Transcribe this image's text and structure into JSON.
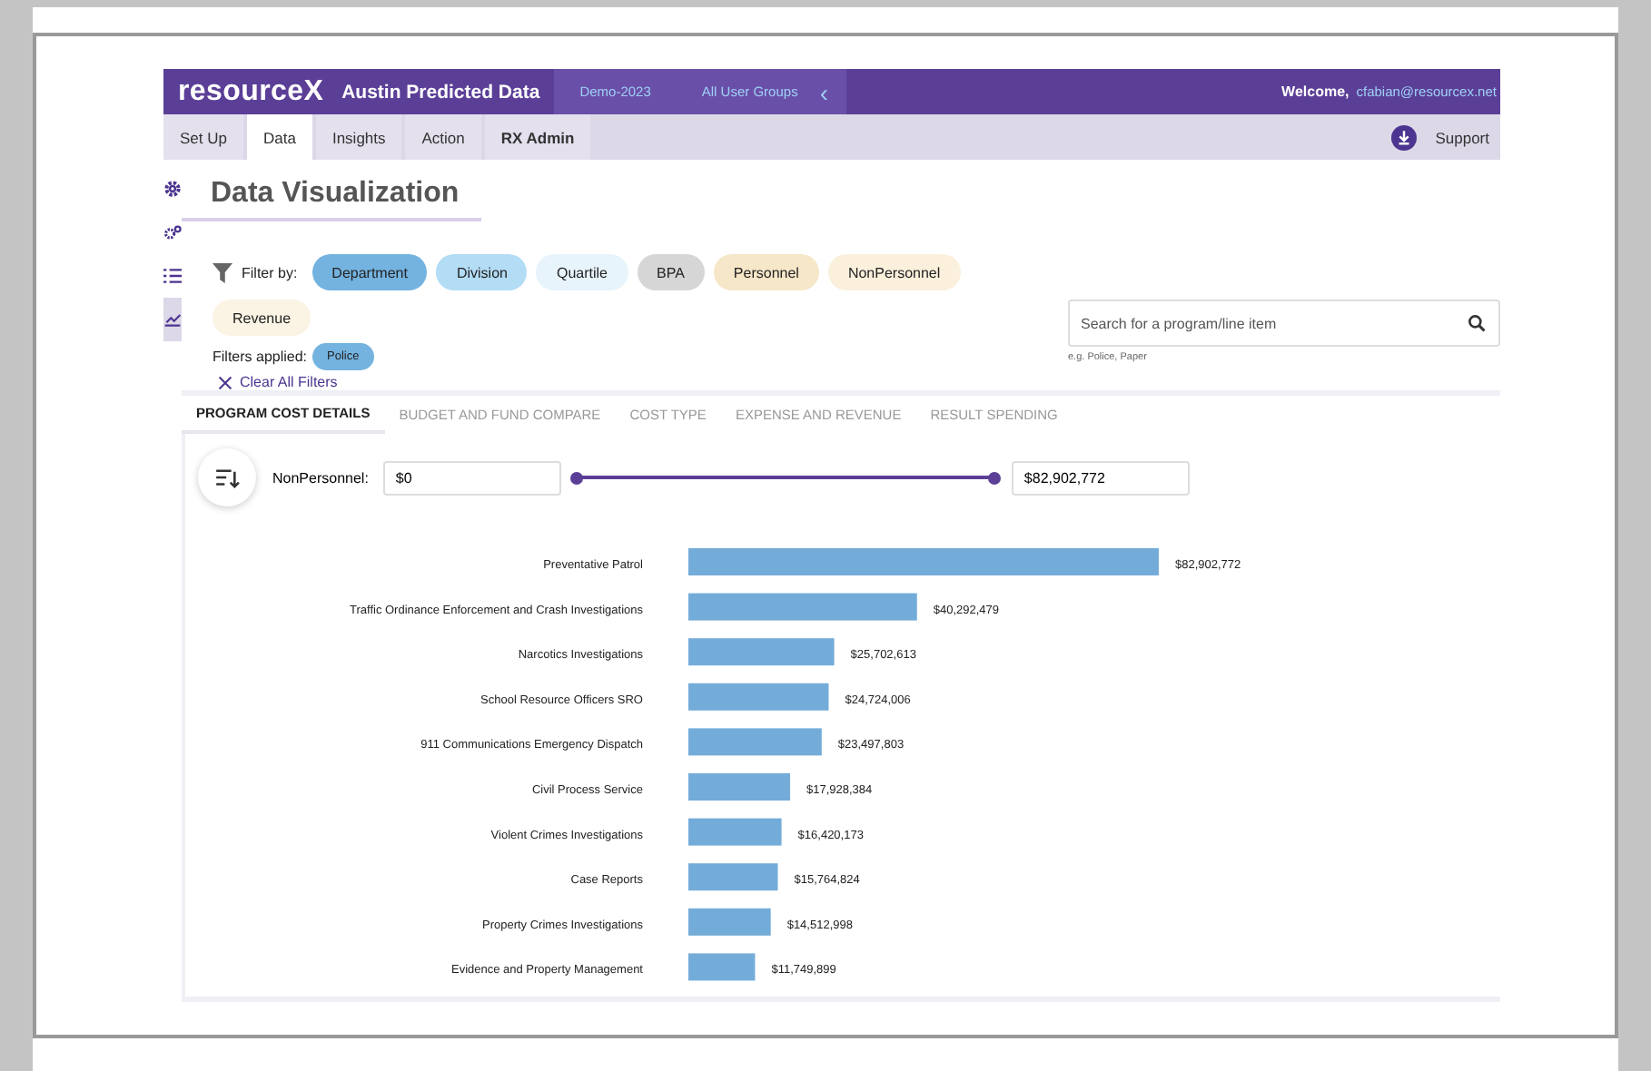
{
  "header": {
    "logo": "resourceX",
    "title": "Austin Predicted Data",
    "year": "Demo-2023",
    "group": "All User Groups",
    "collapse": "‹",
    "welcome": "Welcome,",
    "user": "cfabian@resourcex.net"
  },
  "nav": [
    {
      "label": "Set Up",
      "selected": false
    },
    {
      "label": "Data",
      "selected": true
    },
    {
      "label": "Insights",
      "selected": false
    },
    {
      "label": "Action",
      "selected": false
    },
    {
      "label": "RX Admin",
      "selected": false
    }
  ],
  "support": "Support",
  "sidebar": [
    {
      "kind": "gear",
      "selected": false
    },
    {
      "kind": "gears",
      "selected": false
    },
    {
      "kind": "list",
      "selected": false
    },
    {
      "kind": "chart",
      "selected": true
    }
  ],
  "page_title": "Data Visualization",
  "filter_label": "Filter by:",
  "filters": [
    {
      "label": "Department",
      "color": "#74b3e0"
    },
    {
      "label": "Division",
      "color": "#b3dcf5"
    },
    {
      "label": "Quartile",
      "color": "#e8f4fc"
    },
    {
      "label": "BPA",
      "color": "#d6d6d6"
    },
    {
      "label": "Personnel",
      "color": "#f6e7c8"
    },
    {
      "label": "NonPersonnel",
      "color": "#faf0dc"
    },
    {
      "label": "Revenue",
      "color": "#fbf3e3"
    }
  ],
  "search": {
    "placeholder": "Search for a program/line item",
    "hint": "e.g. Police, Paper"
  },
  "applied_label": "Filters applied:",
  "applied": [
    {
      "label": "Police",
      "color": "#74b3e0"
    }
  ],
  "clear": "Clear All Filters",
  "tabs": [
    {
      "label": "PROGRAM COST DETAILS",
      "selected": true
    },
    {
      "label": "BUDGET AND FUND COMPARE",
      "selected": false
    },
    {
      "label": "COST TYPE",
      "selected": false
    },
    {
      "label": "EXPENSE AND REVENUE",
      "selected": false
    },
    {
      "label": "RESULT SPENDING",
      "selected": false
    }
  ],
  "range": {
    "label": "NonPersonnel:",
    "min": "$0",
    "max": "$82,902,772",
    "level": 1
  },
  "chart_data": {
    "type": "bar",
    "orientation": "horizontal",
    "categories": [
      "Preventative Patrol",
      "Traffic Ordinance Enforcement and Crash Investigations",
      "Narcotics Investigations",
      "School Resource Officers SRO",
      "911 Communications Emergency Dispatch",
      "Civil Process Service",
      "Violent Crimes Investigations",
      "Case Reports",
      "Property Crimes Investigations",
      "Evidence and Property Management"
    ],
    "series": [
      {
        "color": "#74acd9",
        "value_labels": [
          "$82,902,772",
          "$40,292,479",
          "$25,702,613",
          "$24,724,006",
          "$23,497,803",
          "$17,928,384",
          "$16,420,173",
          "$15,764,824",
          "$14,512,998",
          "$11,749,899"
        ],
        "values": [
          82902772,
          40292479,
          25702613,
          24724006,
          23497803,
          17928384,
          16420173,
          15764824,
          14512998,
          11749899
        ]
      }
    ]
  }
}
